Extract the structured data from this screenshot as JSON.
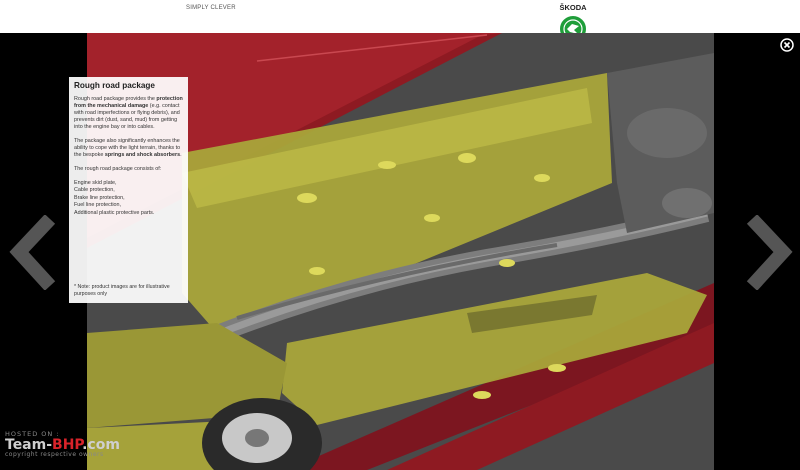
{
  "header": {
    "slogan": "SIMPLY CLEVER",
    "brand": "ŠKODA",
    "logo_icon": "skoda-winged-arrow-logo"
  },
  "controls": {
    "close_icon": "close-icon",
    "prev_icon": "chevron-left-icon",
    "next_icon": "chevron-right-icon"
  },
  "panel": {
    "title": "Rough road package",
    "p1_a": "Rough road package provides the ",
    "p1_bold": "protection from the mechanical damage",
    "p1_b": " (e.g. contact with road imperfections or flying debris), and prevents dirt (dust, sand, mud) from getting into the engine bay or into cables.",
    "p2_a": "The package also significantly enhances the ability to cope with the light terrain, thanks to the bespoke ",
    "p2_bold": "springs and shock absorbers",
    "p2_b": ".",
    "p3": "The rough road package consists of:",
    "items": [
      "Engine skid plate,",
      "Cable protection,",
      "Brake line protection,",
      "Fuel line protection,",
      "Additional plastic protective parts."
    ],
    "note": "* Note: product images are for illustrative purposes only"
  },
  "watermark": {
    "hosted": "HOSTED ON :",
    "logo_a": "Team-",
    "logo_b": "BHP",
    "logo_c": ".com",
    "copyright": "copyright respective owners"
  },
  "colors": {
    "background": "#000000",
    "car_body": "#8e1a22",
    "underbody_protection": "#b8b43a",
    "chassis": "#5a5a5a"
  }
}
